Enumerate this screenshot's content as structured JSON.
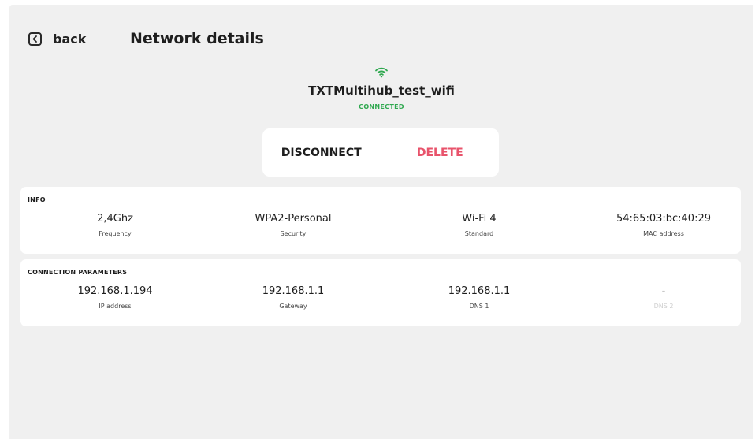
{
  "header": {
    "back_label": "back",
    "title": "Network details"
  },
  "network": {
    "icon": "wifi-icon",
    "ssid": "TXTMultihub_test_wifi",
    "status": "CONNECTED",
    "status_color": "#2fa84f"
  },
  "actions": {
    "disconnect_label": "DISCONNECT",
    "delete_label": "DELETE",
    "delete_color": "#e8536b"
  },
  "info": {
    "heading": "INFO",
    "fields": [
      {
        "value": "2,4Ghz",
        "label": "Frequency"
      },
      {
        "value": "WPA2-Personal",
        "label": "Security"
      },
      {
        "value": "Wi-Fi 4",
        "label": "Standard"
      },
      {
        "value": "54:65:03:bc:40:29",
        "label": "MAC address"
      }
    ]
  },
  "connection": {
    "heading": "CONNECTION PARAMETERS",
    "fields": [
      {
        "value": "192.168.1.194",
        "label": "IP address"
      },
      {
        "value": "192.168.1.1",
        "label": "Gateway"
      },
      {
        "value": "192.168.1.1",
        "label": "DNS 1"
      },
      {
        "value": "-",
        "label": "DNS 2"
      }
    ]
  }
}
